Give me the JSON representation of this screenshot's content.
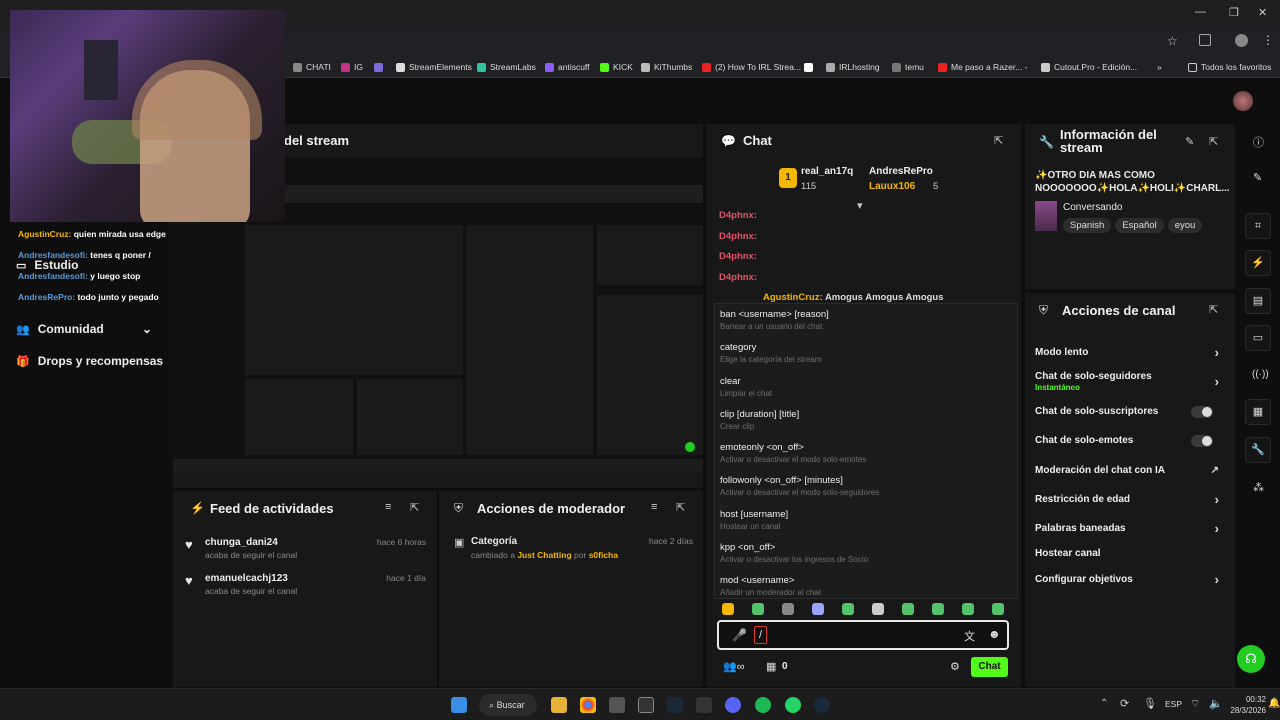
{
  "browser": {
    "bookmarks": [
      "CHATI",
      "IG",
      "StreamElements",
      "StreamLabs",
      "antiscuff",
      "KICK",
      "KiThumbs",
      "(2) How To IRL Strea...",
      "IRLhosting",
      "temu",
      "Me paso a Razer... -",
      "Cutout.Pro - Edición...",
      "Todos los favoritos"
    ]
  },
  "sidebar": {
    "items": [
      "Estudio",
      "Comunidad",
      "Drops y recompensas"
    ]
  },
  "overlay_chat": [
    {
      "user": "AgustinCruz:",
      "text": "quien mirada usa edge"
    },
    {
      "user": "Andresfandesofi:",
      "text": "tenes q poner /"
    },
    {
      "user": "Andresfandesofi:",
      "text": "y luego stop"
    },
    {
      "user": "AndresRePro:",
      "text": "todo junto y pegado"
    }
  ],
  "stream_panel": {
    "title": "del stream"
  },
  "activity_feed": {
    "title": "Feed de actividades",
    "items": [
      {
        "user": "chunga_dani24",
        "sub": "acaba de seguir el canal",
        "time": "hace 6 horas"
      },
      {
        "user": "emanuelcachj123",
        "sub": "acaba de seguir el canal",
        "time": "hace 1 día"
      }
    ]
  },
  "mod_actions": {
    "title": "Acciones de moderador",
    "item": {
      "label": "Categoría",
      "changed": "cambiado a",
      "category": "Just Chatting",
      "por": "por",
      "user": "s0ficha",
      "time": "hace 2 días"
    }
  },
  "chat": {
    "title": "Chat",
    "leaderboard": [
      {
        "rank": "1",
        "name": "real_an17q",
        "points": "115"
      },
      {
        "name": "AndresRePro",
        "points": ""
      },
      {
        "name": "Lauux106",
        "points": "5"
      }
    ],
    "messages": [
      {
        "user": "D4phnx:"
      },
      {
        "user": "D4phnx:"
      },
      {
        "user": "D4phnx:"
      },
      {
        "user": "D4phnx:"
      }
    ],
    "partial_message": {
      "user": "AgustinCruz:",
      "text": "Amogus Amogus Amogus"
    },
    "commands": [
      {
        "cmd": "ban <username> [reason]",
        "desc": "Banear a un usuario del chat"
      },
      {
        "cmd": "category",
        "desc": "Elige la categoría del stream"
      },
      {
        "cmd": "clear",
        "desc": "Limpiar el chat"
      },
      {
        "cmd": "clip [duration] [title]",
        "desc": "Crear clip"
      },
      {
        "cmd": "emoteonly <on_off>",
        "desc": "Activar o desactivar el modo solo-emotes"
      },
      {
        "cmd": "followonly <on_off> [minutes]",
        "desc": "Activar o desactivar el modo solo-seguidores"
      },
      {
        "cmd": "host [username]",
        "desc": "Hostear un canal"
      },
      {
        "cmd": "kpp <on_off>",
        "desc": "Activar o desactivar los ingresos de Socio"
      },
      {
        "cmd": "mod <username>",
        "desc": "Añadir un moderador al chat"
      }
    ],
    "input_value": "/",
    "footer": {
      "points": "0",
      "send_label": "Chat"
    }
  },
  "stream_info": {
    "title": "Información del stream",
    "stream_title": "✨OTRO DIA MAS COMO NOOOOOOO✨HOLA✨HOLI✨CHARL...",
    "category": "Conversando",
    "tags": [
      "Spanish",
      "Español",
      "eyou"
    ]
  },
  "channel_actions": {
    "title": "Acciones de canal",
    "items": [
      {
        "label": "Modo lento",
        "control": "chevron"
      },
      {
        "label": "Chat de solo-seguidores",
        "sub": "Instantáneo",
        "control": "chevron"
      },
      {
        "label": "Chat de solo-suscriptores",
        "control": "toggle"
      },
      {
        "label": "Chat de solo-emotes",
        "control": "toggle"
      },
      {
        "label": "Moderación del chat con IA",
        "control": "external"
      },
      {
        "label": "Restricción de edad",
        "control": "chevron"
      },
      {
        "label": "Palabras baneadas",
        "control": "chevron"
      },
      {
        "label": "Hostear canal",
        "control": "none"
      },
      {
        "label": "Configurar objetivos",
        "control": "chevron"
      }
    ]
  },
  "taskbar": {
    "search": "Buscar",
    "lang": "ESP",
    "time": "00:32",
    "date": "28/3/2026"
  },
  "colors": {
    "accent": "#53fc18",
    "brand_green": "#53c26b",
    "name_red": "#e0556a",
    "name_gold": "#f5b700"
  }
}
